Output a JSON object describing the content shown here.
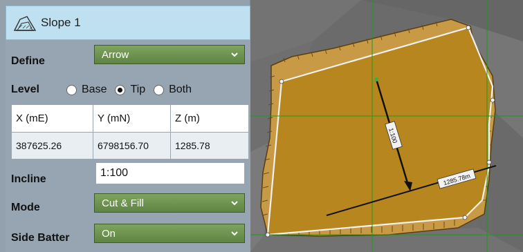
{
  "panel": {
    "title": "Slope 1",
    "define": {
      "label": "Define",
      "value": "Arrow"
    },
    "level": {
      "label": "Level",
      "options": [
        "Base",
        "Tip",
        "Both"
      ],
      "selected": "Tip"
    },
    "coords": {
      "headers": [
        "X (mE)",
        "Y (mN)",
        "Z (m)"
      ],
      "values": [
        "387625.26",
        "6798156.70",
        "1285.78"
      ]
    },
    "incline": {
      "label": "Incline",
      "value": "1:100"
    },
    "mode": {
      "label": "Mode",
      "value": "Cut & Fill"
    },
    "side_batter": {
      "label": "Side Batter",
      "value": "On"
    }
  },
  "map": {
    "arrow_label": "1:100",
    "level_label": "1285.78m",
    "pad_color": "#b8861e",
    "rim_color": "#d8b06a",
    "grid_color": "#1a9c1a"
  }
}
